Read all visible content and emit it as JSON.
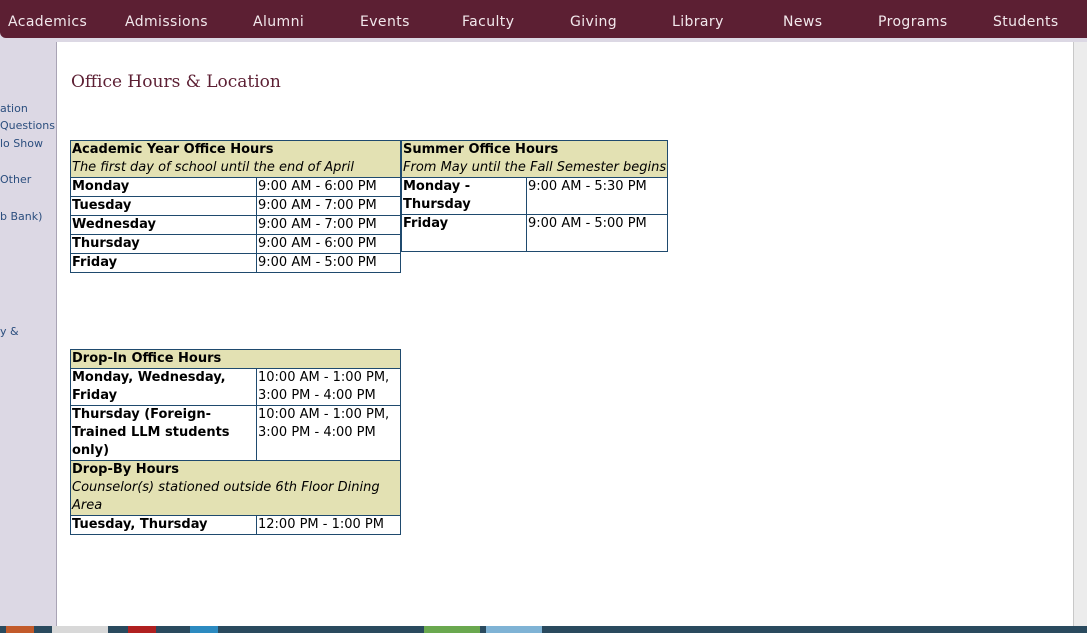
{
  "topnav": {
    "items": [
      "Academics",
      "Admissions",
      "Alumni",
      "Events",
      "Faculty",
      "Giving",
      "Library",
      "News",
      "Programs",
      "Students"
    ]
  },
  "leftnav": {
    "items": [
      "ation",
      "Questions",
      "lo Show",
      "Other",
      "b Bank)",
      "y &"
    ]
  },
  "page": {
    "title": "Office Hours & Location"
  },
  "academic": {
    "title": "Academic Year Office Hours",
    "subtitle": "The first day of school until the end of April",
    "rows": [
      {
        "day": "Monday",
        "hours": "9:00 AM - 6:00 PM"
      },
      {
        "day": "Tuesday",
        "hours": "9:00 AM - 7:00 PM"
      },
      {
        "day": "Wednesday",
        "hours": "9:00 AM - 7:00 PM"
      },
      {
        "day": "Thursday",
        "hours": "9:00 AM - 6:00 PM"
      },
      {
        "day": "Friday",
        "hours": "9:00 AM - 5:00 PM"
      }
    ]
  },
  "summer": {
    "title": "Summer Office Hours",
    "subtitle": "From May until the Fall Semester begins",
    "rows": [
      {
        "day": "Monday - Thursday",
        "hours": "9:00 AM - 5:30 PM"
      },
      {
        "day": "Friday",
        "hours": "9:00 AM - 5:00 PM"
      }
    ]
  },
  "dropin": {
    "title": "Drop-In Office Hours",
    "rows": [
      {
        "day": "Monday, Wednesday, Friday",
        "hours": "10:00 AM - 1:00 PM, 3:00 PM - 4:00 PM"
      },
      {
        "day": "Thursday (Foreign-Trained LLM students only)",
        "hours": "10:00 AM - 1:00 PM, 3:00 PM - 4:00 PM"
      }
    ],
    "dropby_title": "Drop-By Hours",
    "dropby_subtitle": "Counselor(s) stationed outside 6th Floor Dining Area",
    "dropby_rows": [
      {
        "day": "Tuesday, Thursday",
        "hours": "12:00 PM - 1:00 PM"
      }
    ]
  },
  "colors": {
    "nav_bg": "#5c1f33",
    "table_header_bg": "#e3e1b3",
    "table_border": "#1f4a6e",
    "title_color": "#5c1f33",
    "sidebar_link": "#2b4e7e"
  }
}
